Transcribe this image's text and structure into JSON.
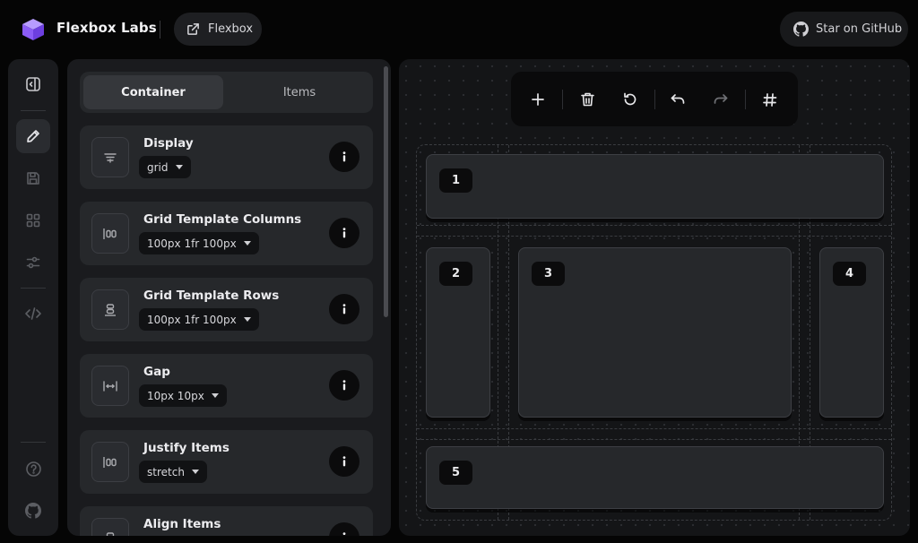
{
  "header": {
    "brand": "Flexbox Labs",
    "link_label": "Flexbox",
    "github_label": "Star on GitHub"
  },
  "rail": {
    "items": [
      {
        "name": "sidebar-toggle-icon",
        "active": false
      },
      {
        "name": "edit-icon",
        "active": true
      },
      {
        "name": "save-icon",
        "active": false
      },
      {
        "name": "grid-icon",
        "active": false
      },
      {
        "name": "settings-sliders-icon",
        "active": false
      },
      {
        "name": "code-icon",
        "active": false
      },
      {
        "name": "help-icon",
        "active": false
      },
      {
        "name": "github-icon",
        "active": false
      }
    ]
  },
  "panel": {
    "tabs": [
      {
        "label": "Container",
        "active": true
      },
      {
        "label": "Items",
        "active": false
      }
    ],
    "properties": [
      {
        "title": "Display",
        "value": "grid",
        "icon": "display-icon"
      },
      {
        "title": "Grid Template Columns",
        "value": "100px 1fr 100px",
        "icon": "columns-icon"
      },
      {
        "title": "Grid Template Rows",
        "value": "100px 1fr 100px",
        "icon": "rows-icon"
      },
      {
        "title": "Gap",
        "value": "10px 10px",
        "icon": "gap-icon"
      },
      {
        "title": "Justify Items",
        "value": "stretch",
        "icon": "justify-icon"
      },
      {
        "title": "Align Items",
        "value": "",
        "icon": "align-icon"
      }
    ]
  },
  "canvas": {
    "toolbar": [
      "add-icon",
      "delete-icon",
      "reset-icon",
      "undo-icon",
      "redo-icon",
      "grid-toggle-icon"
    ],
    "items": [
      "1",
      "2",
      "3",
      "4",
      "5"
    ]
  },
  "colors": {
    "accent": "#8b5cf6",
    "background": "#050505",
    "surface": "#1a1b1e",
    "card": "#26282b"
  }
}
